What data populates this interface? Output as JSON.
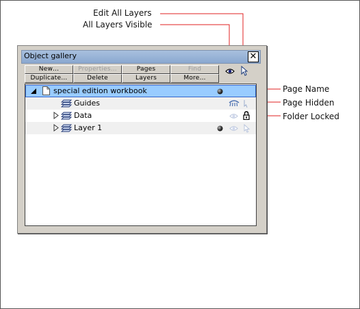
{
  "callouts": {
    "edit_all_layers": "Edit All Layers",
    "all_layers_visible": "All Layers Visible",
    "page_name": "Page Name",
    "page_hidden": "Page Hidden",
    "folder_locked": "Folder Locked"
  },
  "gallery": {
    "title": "Object gallery",
    "close_label": "✕",
    "buttons": {
      "new": "New…",
      "properties": "Properties…",
      "pages": "Pages",
      "find": "Find",
      "duplicate": "Duplicate…",
      "delete": "Delete",
      "layers": "Layers",
      "more": "More…"
    },
    "rows": [
      {
        "label": "special edition workbook"
      },
      {
        "label": "Guides"
      },
      {
        "label": "Data"
      },
      {
        "label": "Layer 1"
      }
    ]
  },
  "colors": {
    "arrow": "#e02020",
    "title_bar": "#8aa8d0",
    "selected_row": "#99ccff"
  },
  "icons": [
    "close-icon",
    "eye-icon",
    "pointer-icon",
    "page-icon",
    "layer-icon",
    "expand-arrow-icon",
    "collapse-arrow-icon",
    "lock-icon",
    "dot-icon"
  ]
}
